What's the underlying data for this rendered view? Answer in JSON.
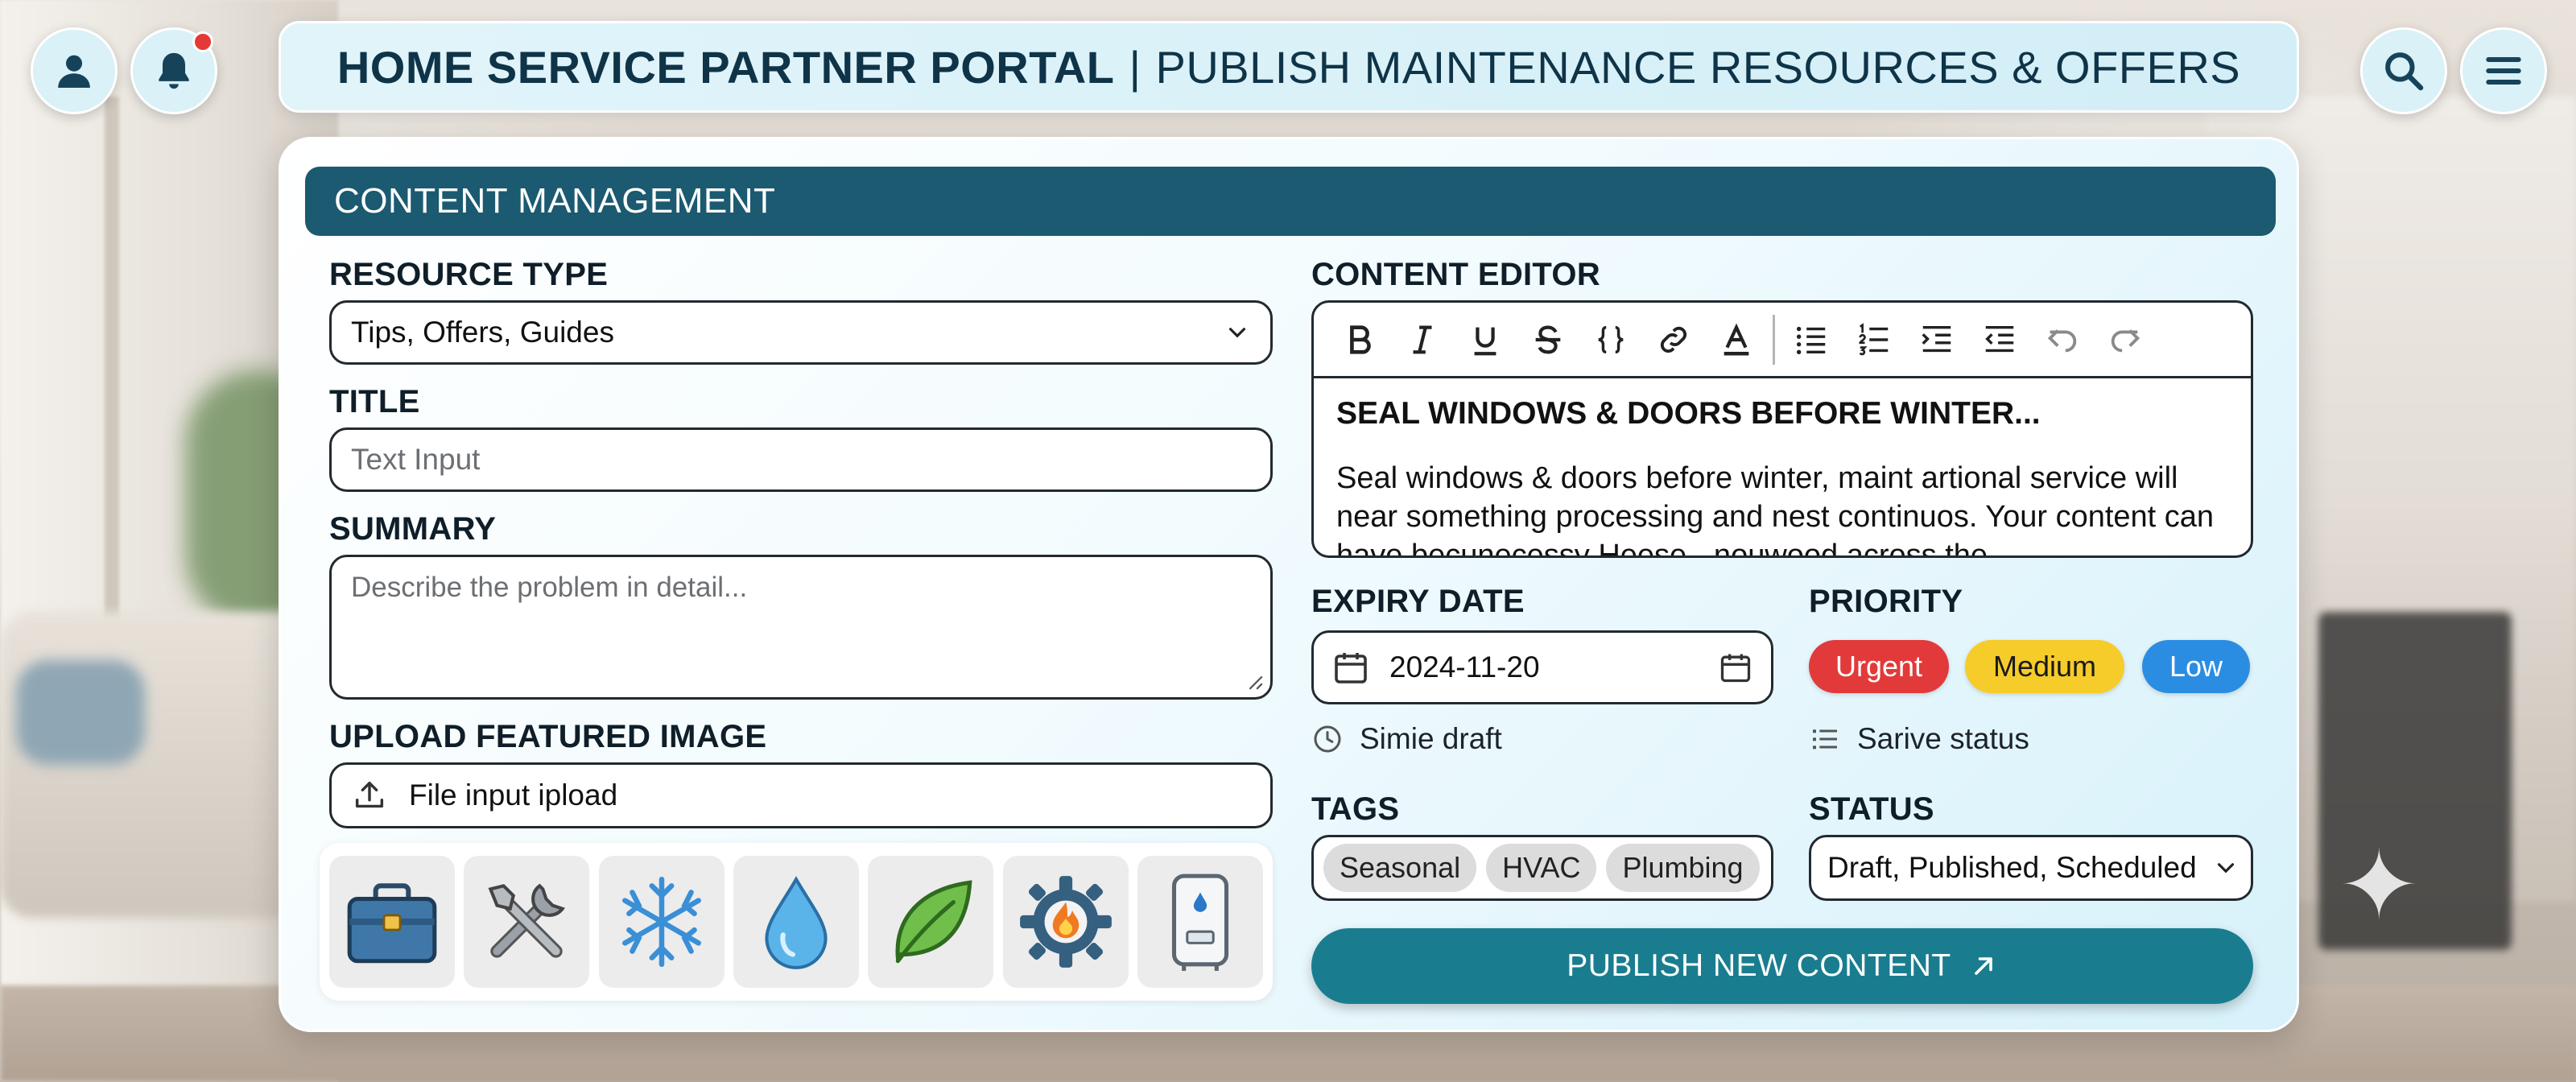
{
  "header": {
    "title_strong": "HOME SERVICE PARTNER PORTAL",
    "separator": "|",
    "title_light": "PUBLISH MAINTENANCE RESOURCES & OFFERS"
  },
  "topbar": {
    "left_icons": [
      "user-icon",
      "bell-icon"
    ],
    "right_icons": [
      "search-icon",
      "menu-icon"
    ],
    "notification_dot_color": "#e53935"
  },
  "card": {
    "title": "CONTENT MANAGEMENT"
  },
  "form": {
    "resource_type": {
      "label": "RESOURCE TYPE",
      "value": "Tips, Offers, Guides"
    },
    "title": {
      "label": "TITLE",
      "placeholder": "Text Input"
    },
    "summary": {
      "label": "SUMMARY",
      "placeholder": "Describe the problem in detail..."
    },
    "upload": {
      "label": "UPLOAD FEATURED IMAGE",
      "button_text": "File input ipload"
    },
    "image_icons": [
      "toolbox-icon",
      "tools-icon",
      "snowflake-icon",
      "water-drop-icon",
      "leaf-icon",
      "gear-flame-icon",
      "water-heater-icon"
    ]
  },
  "editor": {
    "label": "CONTENT EDITOR",
    "toolbar": [
      "bold-icon",
      "italic-icon",
      "underline-icon",
      "strikethrough-icon",
      "code-icon",
      "link-icon",
      "text-color-icon",
      "bullet-list-icon",
      "numbered-list-icon",
      "indent-icon",
      "outdent-icon",
      "undo-icon",
      "redo-icon"
    ],
    "heading": "SEAL WINDOWS & DOORS BEFORE WINTER...",
    "body": "Seal windows & doors before winter, maint artional service will near something processing and nest continuos. Your content can have becunecessy Heese - nouwood across the"
  },
  "expiry": {
    "label": "EXPIRY DATE",
    "value": "2024-11-20",
    "draft_note": "Simie draft"
  },
  "priority": {
    "label": "PRIORITY",
    "options": [
      {
        "label": "Urgent",
        "color": "#e23a3a"
      },
      {
        "label": "Medium",
        "color": "#f6cc2a"
      },
      {
        "label": "Low",
        "color": "#2b8de2"
      }
    ],
    "status_note": "Sarive status"
  },
  "tags": {
    "label": "TAGS",
    "items": [
      "Seasonal",
      "HVAC",
      "Plumbing"
    ]
  },
  "status": {
    "label": "STATUS",
    "value": "Draft, Published, Scheduled"
  },
  "publish": {
    "label": "PUBLISH NEW CONTENT",
    "color": "#197d8f"
  },
  "colors": {
    "accent": "#1b5a70",
    "header_bg": "#d3eef7"
  }
}
